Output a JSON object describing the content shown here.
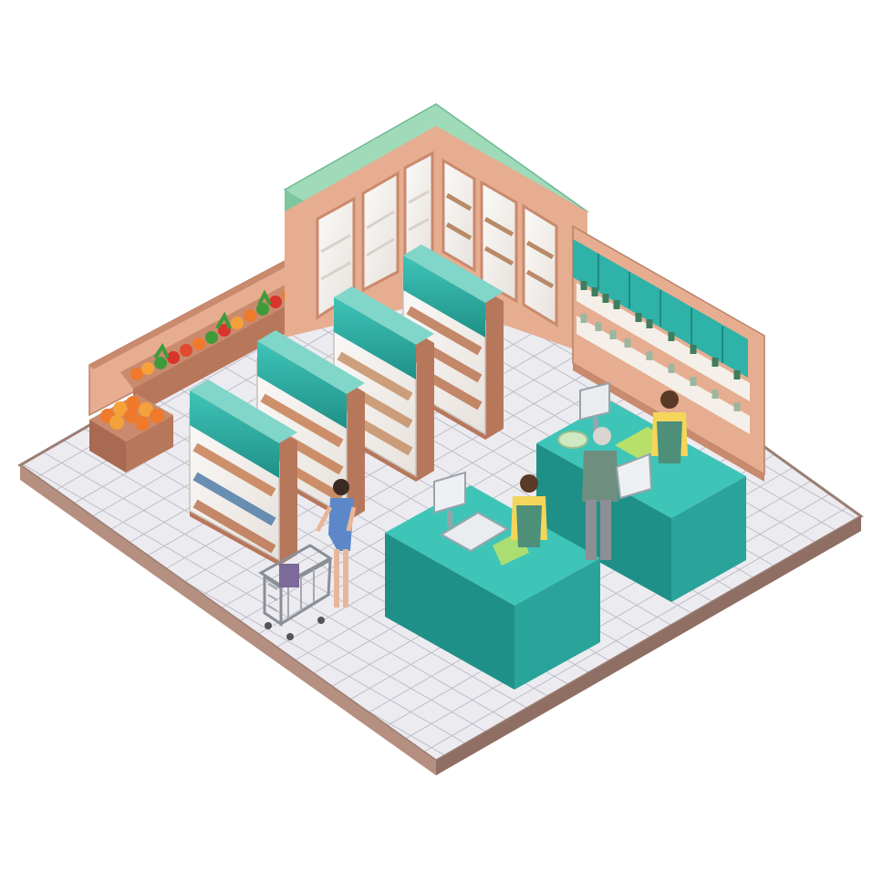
{
  "scene": {
    "description_visible_text": [],
    "palette": {
      "floor_tile": "#ecebf0",
      "floor_grout": "#b9b8c4",
      "floor_edge": "#9b7e73",
      "wall": "#e6ad91",
      "wall_dark": "#c98a6e",
      "wall_top": "#9fdbb9",
      "teal": "#2fb2a8",
      "teal_dark": "#1d8b83",
      "teal_light": "#7fd6c9",
      "glass": "#f4f1ee",
      "produce_orange": "#f07a2c",
      "produce_red": "#d9342b",
      "produce_green": "#3f9b3a",
      "shirt_yellow": "#f3d65a",
      "apron_green": "#4e8f79",
      "dress_blue": "#5c87c9"
    },
    "icons": {
      "shopping_cart": "shopping-cart-icon",
      "register_monitor": "register-monitor-icon"
    }
  }
}
